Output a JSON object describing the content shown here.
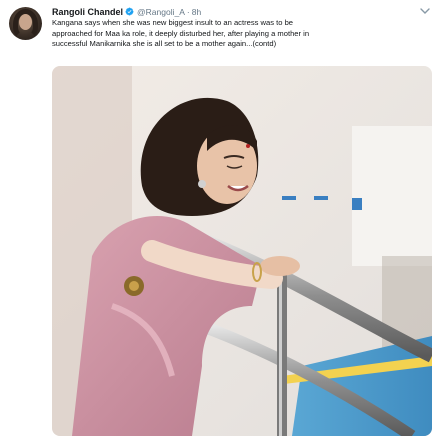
{
  "tweet": {
    "author_name": "Rangoli Chandel",
    "handle": "@Rangoli_A",
    "separator": "·",
    "time": "8h",
    "text_lines": [
      "Kangana says when she was new biggest insult to an actress was to be",
      "approached for Maa ka role, it deeply disturbed her, after playing a mother in",
      "successful Manikarnika she is all set to be a mother again...(contd)"
    ],
    "verified": true
  },
  "icons": {
    "verified": "verified-badge-icon",
    "menu": "chevron-down-icon"
  },
  "colors": {
    "verified": "#1da1f2",
    "secondary_text": "#657786",
    "primary_text": "#14171a"
  }
}
